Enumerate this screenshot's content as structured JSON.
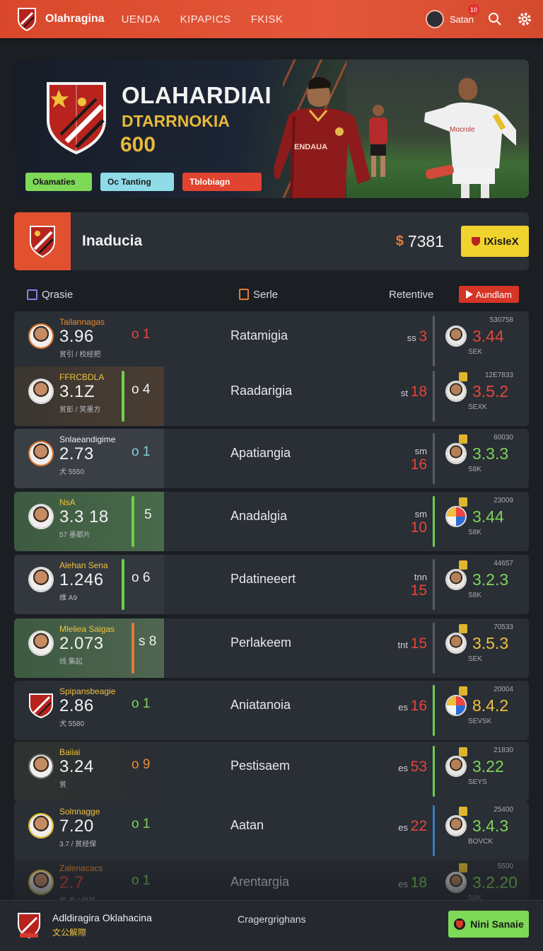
{
  "nav": {
    "brand": "Olahragina",
    "links": [
      "UENDA",
      "KIPAPICS",
      "FKISK"
    ],
    "user_name": "Satan",
    "notif_count": "10",
    "accent": "#e0502f"
  },
  "hero": {
    "title": "OLAHARDIAI",
    "subtitle": "DTARRNOKIA",
    "number": "600",
    "chips": [
      "Okamaties",
      "Oc Tanting",
      "Tblobiagn"
    ],
    "kit_text": "ENDAUA",
    "kit_text2": "Mocrole"
  },
  "team": {
    "name": "Inaducia",
    "score": "7381",
    "button": "IXisIeX"
  },
  "table": {
    "col1": "Qrasie",
    "col2": "Serle",
    "col3": "Retentive",
    "action": "Aundlam"
  },
  "rows": [
    {
      "name": "Tailannagas",
      "name_color": "c-orange",
      "value": "3.96",
      "meta": "贫引 / 校经把",
      "ostat": "o 1",
      "ostat_color": "c-red",
      "mid": "Ratamigia",
      "code": "ss",
      "code_num": "3",
      "rsmall": "530758",
      "rval": "3.44",
      "rval_color": "c-red",
      "rsub": "SEK"
    },
    {
      "name": "FFRCBDLA",
      "name_color": "c-yellow",
      "value": "3.1Z",
      "meta": "贫彭 / 笑墨方",
      "ostat": "o 4",
      "ostat_color": "c-white",
      "mid": "Raadarigia",
      "code": "st",
      "code_num": "18",
      "rsmall": "12E7833",
      "rval": "3.5.2",
      "rval_color": "c-red",
      "rsub": "SEXK"
    },
    {
      "name": "Snlaeandigime",
      "name_color": "c-white",
      "value": "2.73",
      "meta": "犬 5550",
      "ostat": "o 1",
      "ostat_color": "c-cyan",
      "mid": "Apatiangia",
      "code": "sm",
      "code_num": "16",
      "rsmall": "60030",
      "rval": "3.3.3",
      "rval_color": "c-green",
      "rsub": "S8K"
    },
    {
      "name": "NsA",
      "name_color": "c-yellow",
      "value": "3.3 18",
      "meta": "57 墨都片",
      "ostat": "5",
      "ostat_color": "c-white",
      "mid": "Anadalgia",
      "code": "sm",
      "code_num": "10",
      "rsmall": "23009",
      "rval": "3.44",
      "rval_color": "c-green",
      "rsub": "S8K"
    },
    {
      "name": "Alehan Sena",
      "name_color": "c-yellow",
      "value": "1.246",
      "meta": "维 A9",
      "ostat": "o 6",
      "ostat_color": "c-white",
      "mid": "Pdatineeert",
      "code": "tnn",
      "code_num": "15",
      "rsmall": "44657",
      "rval": "3.2.3",
      "rval_color": "c-green",
      "rsub": "S8K"
    },
    {
      "name": "Mleliea Saigas",
      "name_color": "c-yellow",
      "value": "2.073",
      "meta": "线 集起",
      "ostat": "s 8",
      "ostat_color": "c-white",
      "mid": "Perlakeem",
      "code": "tnt",
      "code_num": "15",
      "rsmall": "70533",
      "rval": "3.5.3",
      "rval_color": "c-yellow",
      "rsub": "SEK"
    },
    {
      "name": "Spipansbeagie",
      "name_color": "c-yellow",
      "value": "2.86",
      "meta": "犬 5580",
      "ostat": "o 1",
      "ostat_color": "c-green",
      "mid": "Aniatanoia",
      "code": "es",
      "code_num": "16",
      "rsmall": "20004",
      "rval": "8.4.2",
      "rval_color": "c-yellow",
      "rsub": "SEVSK"
    },
    {
      "name": "Baiiai",
      "name_color": "c-yellow",
      "value": "3.24",
      "meta": "贫",
      "ostat": "o 9",
      "ostat_color": "c-orange",
      "mid": "Pestisaem",
      "code": "es",
      "code_num": "53",
      "rsmall": "21830",
      "rval": "3.22",
      "rval_color": "c-green",
      "rsub": "SEYS"
    },
    {
      "name": "Solnnagge",
      "name_color": "c-yellow",
      "value": "7.20",
      "meta": "3.7 / 贫经保",
      "ostat": "o 1",
      "ostat_color": "c-green",
      "mid": "Aatan",
      "code": "es",
      "code_num": "22",
      "rsmall": "25400",
      "rval": "3.4.3",
      "rval_color": "c-green",
      "rsub": "BOVCK"
    },
    {
      "name": "Zalenacacs",
      "name_color": "c-orange",
      "value": "2.7",
      "meta": "贫 方 / 经将",
      "ostat": "o 1",
      "ostat_color": "c-green",
      "mid": "Arentargia",
      "code": "es",
      "code_num": "18",
      "rsmall": "5500",
      "rval": "3.2.20",
      "rval_color": "c-green",
      "rsub": "S8K"
    }
  ],
  "footer": {
    "name": "Adldiragira Oklahacina",
    "sub": "文公解際",
    "mid": "Cragergrighans",
    "button": "Nini Sanaie"
  }
}
